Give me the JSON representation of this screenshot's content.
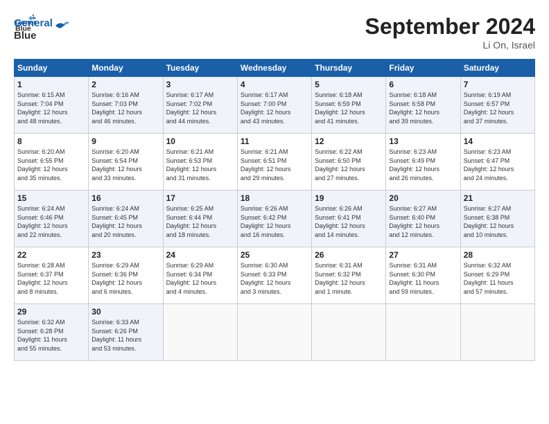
{
  "header": {
    "logo_line1": "General",
    "logo_line2": "Blue",
    "month_title": "September 2024",
    "location": "Li On, Israel"
  },
  "weekdays": [
    "Sunday",
    "Monday",
    "Tuesday",
    "Wednesday",
    "Thursday",
    "Friday",
    "Saturday"
  ],
  "weeks": [
    [
      {
        "day": "1",
        "info": "Sunrise: 6:15 AM\nSunset: 7:04 PM\nDaylight: 12 hours\nand 48 minutes."
      },
      {
        "day": "2",
        "info": "Sunrise: 6:16 AM\nSunset: 7:03 PM\nDaylight: 12 hours\nand 46 minutes."
      },
      {
        "day": "3",
        "info": "Sunrise: 6:17 AM\nSunset: 7:02 PM\nDaylight: 12 hours\nand 44 minutes."
      },
      {
        "day": "4",
        "info": "Sunrise: 6:17 AM\nSunset: 7:00 PM\nDaylight: 12 hours\nand 43 minutes."
      },
      {
        "day": "5",
        "info": "Sunrise: 6:18 AM\nSunset: 6:59 PM\nDaylight: 12 hours\nand 41 minutes."
      },
      {
        "day": "6",
        "info": "Sunrise: 6:18 AM\nSunset: 6:58 PM\nDaylight: 12 hours\nand 39 minutes."
      },
      {
        "day": "7",
        "info": "Sunrise: 6:19 AM\nSunset: 6:57 PM\nDaylight: 12 hours\nand 37 minutes."
      }
    ],
    [
      {
        "day": "8",
        "info": "Sunrise: 6:20 AM\nSunset: 6:55 PM\nDaylight: 12 hours\nand 35 minutes."
      },
      {
        "day": "9",
        "info": "Sunrise: 6:20 AM\nSunset: 6:54 PM\nDaylight: 12 hours\nand 33 minutes."
      },
      {
        "day": "10",
        "info": "Sunrise: 6:21 AM\nSunset: 6:53 PM\nDaylight: 12 hours\nand 31 minutes."
      },
      {
        "day": "11",
        "info": "Sunrise: 6:21 AM\nSunset: 6:51 PM\nDaylight: 12 hours\nand 29 minutes."
      },
      {
        "day": "12",
        "info": "Sunrise: 6:22 AM\nSunset: 6:50 PM\nDaylight: 12 hours\nand 27 minutes."
      },
      {
        "day": "13",
        "info": "Sunrise: 6:23 AM\nSunset: 6:49 PM\nDaylight: 12 hours\nand 26 minutes."
      },
      {
        "day": "14",
        "info": "Sunrise: 6:23 AM\nSunset: 6:47 PM\nDaylight: 12 hours\nand 24 minutes."
      }
    ],
    [
      {
        "day": "15",
        "info": "Sunrise: 6:24 AM\nSunset: 6:46 PM\nDaylight: 12 hours\nand 22 minutes."
      },
      {
        "day": "16",
        "info": "Sunrise: 6:24 AM\nSunset: 6:45 PM\nDaylight: 12 hours\nand 20 minutes."
      },
      {
        "day": "17",
        "info": "Sunrise: 6:25 AM\nSunset: 6:44 PM\nDaylight: 12 hours\nand 18 minutes."
      },
      {
        "day": "18",
        "info": "Sunrise: 6:26 AM\nSunset: 6:42 PM\nDaylight: 12 hours\nand 16 minutes."
      },
      {
        "day": "19",
        "info": "Sunrise: 6:26 AM\nSunset: 6:41 PM\nDaylight: 12 hours\nand 14 minutes."
      },
      {
        "day": "20",
        "info": "Sunrise: 6:27 AM\nSunset: 6:40 PM\nDaylight: 12 hours\nand 12 minutes."
      },
      {
        "day": "21",
        "info": "Sunrise: 6:27 AM\nSunset: 6:38 PM\nDaylight: 12 hours\nand 10 minutes."
      }
    ],
    [
      {
        "day": "22",
        "info": "Sunrise: 6:28 AM\nSunset: 6:37 PM\nDaylight: 12 hours\nand 8 minutes."
      },
      {
        "day": "23",
        "info": "Sunrise: 6:29 AM\nSunset: 6:36 PM\nDaylight: 12 hours\nand 6 minutes."
      },
      {
        "day": "24",
        "info": "Sunrise: 6:29 AM\nSunset: 6:34 PM\nDaylight: 12 hours\nand 4 minutes."
      },
      {
        "day": "25",
        "info": "Sunrise: 6:30 AM\nSunset: 6:33 PM\nDaylight: 12 hours\nand 3 minutes."
      },
      {
        "day": "26",
        "info": "Sunrise: 6:31 AM\nSunset: 6:32 PM\nDaylight: 12 hours\nand 1 minute."
      },
      {
        "day": "27",
        "info": "Sunrise: 6:31 AM\nSunset: 6:30 PM\nDaylight: 11 hours\nand 59 minutes."
      },
      {
        "day": "28",
        "info": "Sunrise: 6:32 AM\nSunset: 6:29 PM\nDaylight: 11 hours\nand 57 minutes."
      }
    ],
    [
      {
        "day": "29",
        "info": "Sunrise: 6:32 AM\nSunset: 6:28 PM\nDaylight: 11 hours\nand 55 minutes."
      },
      {
        "day": "30",
        "info": "Sunrise: 6:33 AM\nSunset: 6:26 PM\nDaylight: 11 hours\nand 53 minutes."
      },
      {
        "day": "",
        "info": ""
      },
      {
        "day": "",
        "info": ""
      },
      {
        "day": "",
        "info": ""
      },
      {
        "day": "",
        "info": ""
      },
      {
        "day": "",
        "info": ""
      }
    ]
  ]
}
